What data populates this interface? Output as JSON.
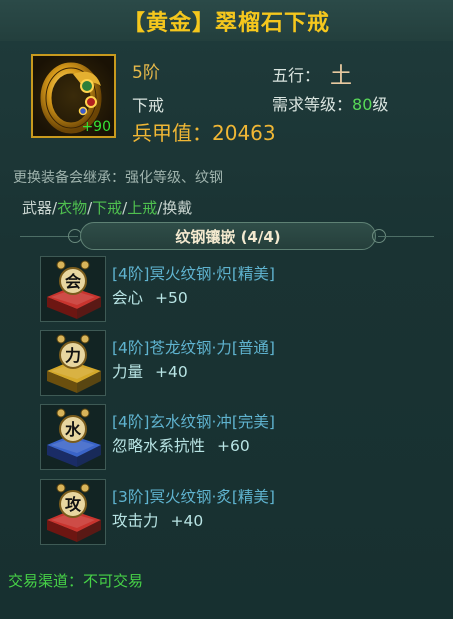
{
  "item": {
    "title": "【黄金】翠榴石下戒",
    "enhance": "+90",
    "tier": "5阶",
    "slot": "下戒",
    "element_label": "五行：",
    "element_value": "土",
    "req_label": "需求等级：",
    "req_level": "80",
    "req_suffix": "级",
    "power_label": "兵甲值：",
    "power_value": "20463"
  },
  "inherit_text": "更换装备会继承：强化等级、纹钢",
  "tabs_cropped": [
    "武器/",
    "衣物",
    "/",
    "下戒",
    "/",
    "上戒",
    "/",
    "换戴"
  ],
  "section": {
    "title": "纹钢镶嵌 (4/4)"
  },
  "gems": [
    {
      "char": "会",
      "name": "[4阶]冥火纹钢·炽[精美]",
      "stat": "会心",
      "value": "+50",
      "color": "#c8342e",
      "color_dark": "#6d1612"
    },
    {
      "char": "力",
      "name": "[4阶]苍龙纹钢·力[普通]",
      "stat": "力量",
      "value": "+40",
      "color": "#d4a82a",
      "color_dark": "#6b4f0e"
    },
    {
      "char": "水",
      "name": "[4阶]玄水纹钢·冲[完美]",
      "stat": "忽略水系抗性",
      "value": "+60",
      "color": "#3a64c8",
      "color_dark": "#1a2c66"
    },
    {
      "char": "攻",
      "name": "[3阶]冥火纹钢·炙[精美]",
      "stat": "攻击力",
      "value": "+40",
      "color": "#c8342e",
      "color_dark": "#6d1612"
    }
  ],
  "trade": "交易渠道：不可交易"
}
